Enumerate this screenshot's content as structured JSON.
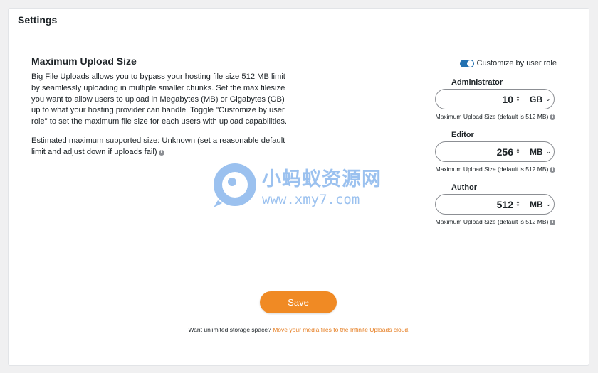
{
  "page": {
    "title": "Settings"
  },
  "section": {
    "title": "Maximum Upload Size",
    "description": "Big File Uploads allows you to bypass your hosting file size 512 MB limit by seamlessly uploading in multiple smaller chunks. Set the max filesize you want to allow users to upload in Megabytes (MB) or Gigabytes (GB) up to what your hosting provider can handle. Toggle \"Customize by user role\" to set the maximum file size for each users with upload capabilities.",
    "estimate": "Estimated maximum supported size: Unknown (set a reasonable default limit and adjust down if uploads fail)"
  },
  "toggle": {
    "label": "Customize by user role",
    "checked": true
  },
  "roles": [
    {
      "label": "Administrator",
      "value": "10",
      "unit": "GB",
      "hint": "Maximum Upload Size (default is 512 MB)"
    },
    {
      "label": "Editor",
      "value": "256",
      "unit": "MB",
      "hint": "Maximum Upload Size (default is 512 MB)"
    },
    {
      "label": "Author",
      "value": "512",
      "unit": "MB",
      "hint": "Maximum Upload Size (default is 512 MB)"
    }
  ],
  "save_label": "Save",
  "footer": {
    "text": "Want unlimited storage space?",
    "link": "Move your media files to the Infinite Uploads cloud",
    "suffix": "."
  },
  "watermark": {
    "title": "小蚂蚁资源网",
    "url": "www.xmy7.com"
  },
  "colors": {
    "accent": "#f08a24",
    "toggle": "#2271b1",
    "link": "#e67e22"
  },
  "icons": {
    "info": "info-icon",
    "spinner": "spinner-arrows-icon",
    "chevron": "chevron-down-icon"
  }
}
